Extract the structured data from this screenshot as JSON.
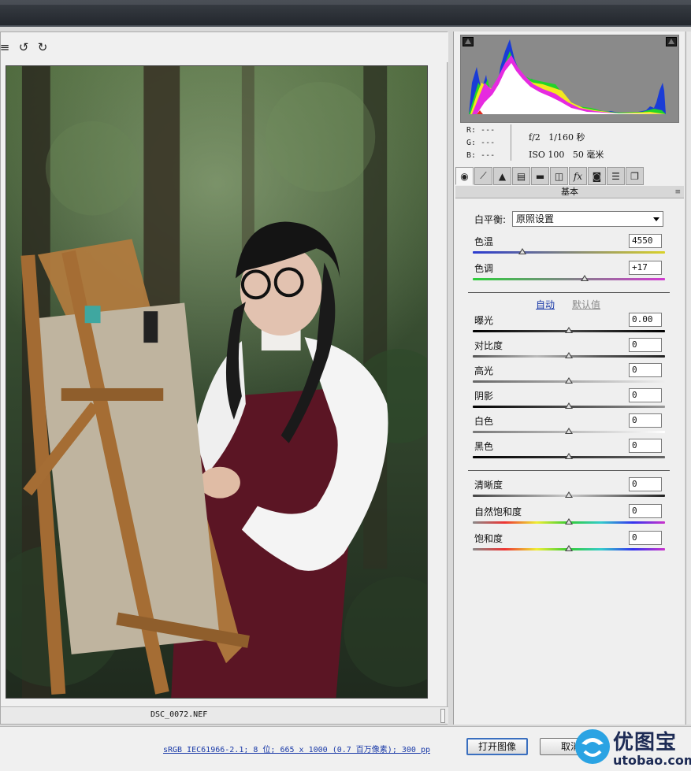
{
  "toolbar": {
    "icons": [
      "menu-icon",
      "rotate-left-icon",
      "rotate-right-icon"
    ],
    "menu_glyph": "≡",
    "rotate_left_glyph": "↺",
    "rotate_right_glyph": "↻"
  },
  "preview": {
    "filename": "DSC_0072.NEF"
  },
  "info": {
    "r": "R: ---",
    "g": "G: ---",
    "b": "B: ---",
    "aperture_shutter": "f/2   1/160 秒",
    "iso_focal": "ISO 100   50 毫米"
  },
  "tabs": {
    "icons": [
      "basic-icon",
      "tone-curve-icon",
      "detail-icon",
      "hsl-icon",
      "split-toning-icon",
      "lens-corrections-icon",
      "effects-icon",
      "camera-calibration-icon",
      "presets-icon",
      "snapshots-icon"
    ],
    "glyphs": [
      "◉",
      "⟋",
      "▲",
      "▤",
      "▬",
      "◫",
      "fx",
      "◙",
      "☰",
      "❐"
    ]
  },
  "panel": {
    "title": "基本",
    "menu_glyph": "≡",
    "white_balance_label": "白平衡:",
    "white_balance_value": "原照设置",
    "temperature_label": "色温",
    "temperature_value": "4550",
    "tint_label": "色调",
    "tint_value": "+17",
    "auto_label": "自动",
    "default_label": "默认值",
    "exposure_label": "曝光",
    "exposure_value": "0.00",
    "contrast_label": "对比度",
    "contrast_value": "0",
    "highlights_label": "高光",
    "highlights_value": "0",
    "shadows_label": "阴影",
    "shadows_value": "0",
    "whites_label": "白色",
    "whites_value": "0",
    "blacks_label": "黑色",
    "blacks_value": "0",
    "clarity_label": "清晰度",
    "clarity_value": "0",
    "vibrance_label": "自然饱和度",
    "vibrance_value": "0",
    "saturation_label": "饱和度",
    "saturation_value": "0"
  },
  "sliders": {
    "temperature": 0.26,
    "tint": 0.58,
    "exposure": 0.5,
    "contrast": 0.5,
    "highlights": 0.5,
    "shadows": 0.5,
    "whites": 0.5,
    "blacks": 0.5,
    "clarity": 0.5,
    "vibrance": 0.5,
    "saturation": 0.5
  },
  "bottom": {
    "status_text": "sRGB IEC61966-2.1; 8 位; 665 x 1000 (0.7 百万像素); 300 pp",
    "open_button": "打开图像",
    "cancel_button": "取消"
  },
  "watermark": {
    "name": "优图宝",
    "url": "utobao.com"
  },
  "colors": {
    "link": "#1a3aa8",
    "titlebar": "#2b2f35",
    "histogram_bg": "#8a8a8a",
    "dress": "#5b1524",
    "blouse": "#f2f2f2"
  }
}
